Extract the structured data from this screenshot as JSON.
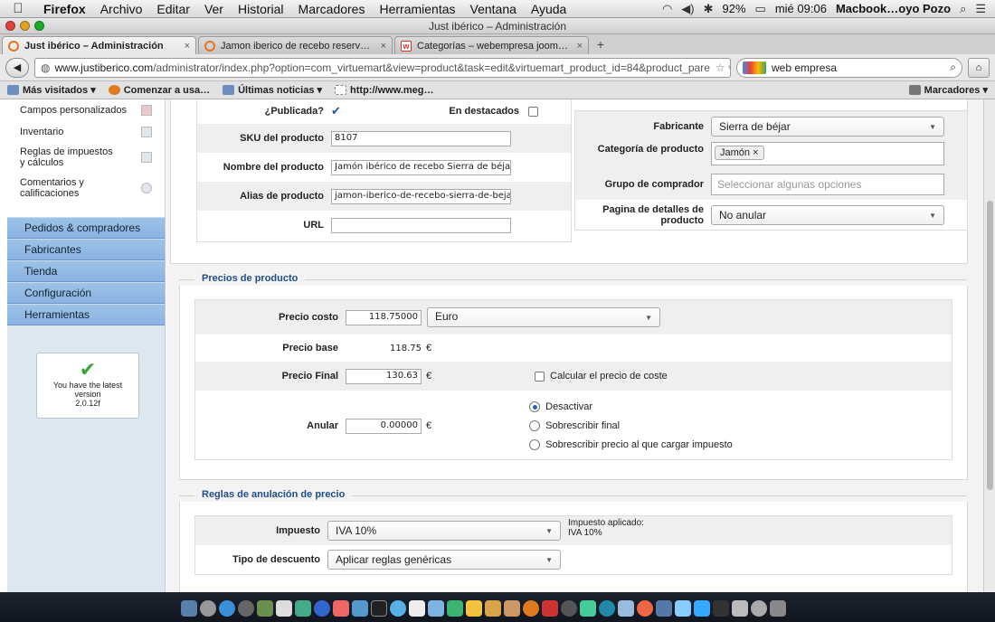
{
  "menubar": {
    "app": "Firefox",
    "items": [
      "Archivo",
      "Editar",
      "Ver",
      "Historial",
      "Marcadores",
      "Herramientas",
      "Ventana",
      "Ayuda"
    ],
    "battery": "92%",
    "clock": "mié 09:06",
    "user": "Macbook…oyo Pozo"
  },
  "window": {
    "title": "Just ibérico – Administración"
  },
  "tabs": [
    {
      "label": "Just ibérico – Administración"
    },
    {
      "label": "Jamon iberico de recebo reserv…"
    },
    {
      "label": "Categorías – webempresa joom…"
    }
  ],
  "nav": {
    "url_domain": "www.justiberico.com",
    "url_path": "/administrator/index.php?option=com_virtuemart&view=product&task=edit&virtuemart_product_id=84&product_pare",
    "search_text": "web empresa"
  },
  "bookmarks": {
    "items": [
      "Más visitados ▾",
      "Comenzar a usa…",
      "Últimas noticias ▾",
      "http://www.meg…"
    ],
    "right": "Marcadores ▾"
  },
  "sidebar": {
    "subitems": [
      "Campos personalizados",
      "Inventario",
      "Reglas de impuestos y cálculos",
      "Comentarios y calificaciones"
    ],
    "menu": [
      "Pedidos & compradores",
      "Fabricantes",
      "Tienda",
      "Configuración",
      "Herramientas"
    ],
    "version": {
      "line1": "You have the latest version",
      "number": "2.0.12f"
    }
  },
  "product": {
    "published_label": "¿Publicada?",
    "featured_label": "En destacados",
    "sku_label": "SKU del producto",
    "sku": "8107",
    "name_label": "Nombre del producto",
    "name": "Jamón ibérico de recebo Sierra de béjar",
    "alias_label": "Alias de producto",
    "alias": "jamon-iberico-de-recebo-sierra-de-bejar",
    "url_label": "URL",
    "url": "",
    "manufacturer_label": "Fabricante",
    "manufacturer": "Sierra de béjar",
    "category_label": "Categoría de producto",
    "category_tag": "Jamón",
    "shopper_label": "Grupo de comprador",
    "shopper_placeholder": "Seleccionar algunas opciones",
    "details_label": "Pagina de detalles de producto",
    "details": "No anular"
  },
  "prices": {
    "legend": "Precios de producto",
    "cost_label": "Precio costo",
    "cost": "118.75000",
    "currency": "Euro",
    "base_label": "Precio base",
    "base": "118.75",
    "final_label": "Precio Final",
    "final": "130.63",
    "euro": "€",
    "calc_label": "Calcular el precio de coste",
    "override_label": "Anular",
    "override": "0.00000",
    "radio1": "Desactivar",
    "radio2": "Sobrescribir final",
    "radio3": "Sobrescribir precio al que cargar impuesto"
  },
  "rules": {
    "legend": "Reglas de anulación de precio",
    "tax_label": "Impuesto",
    "tax": "IVA 10%",
    "applied_label": "Impuesto aplicado:",
    "applied": "IVA 10%",
    "discount_label": "Tipo de descuento",
    "discount": "Aplicar reglas genéricas"
  }
}
